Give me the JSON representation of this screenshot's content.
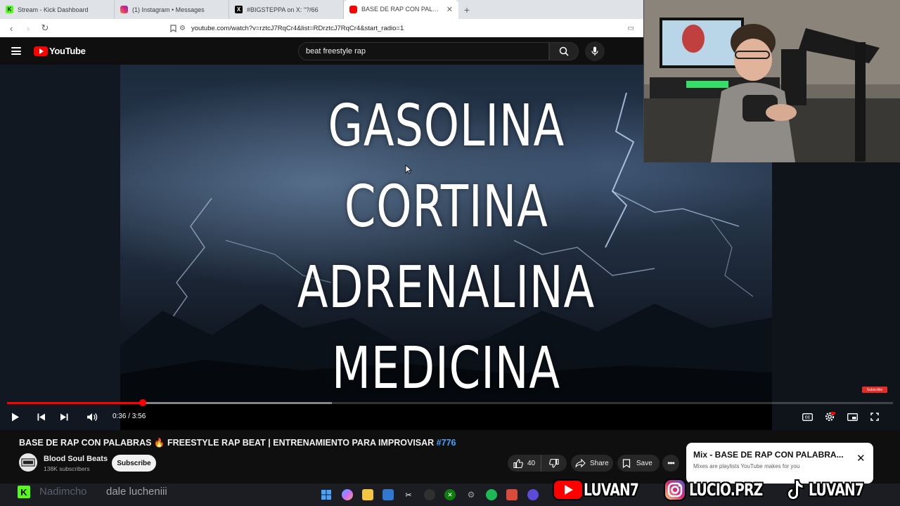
{
  "browser": {
    "tabs": [
      {
        "title": "Stream - Kick Dashboard",
        "icon": "kick-icon",
        "active": false
      },
      {
        "title": "(1) Instagram • Messages",
        "icon": "instagram-icon",
        "active": false
      },
      {
        "title": "#BIGSTEPPA on X: \"?/66",
        "icon": "x-icon",
        "active": false
      },
      {
        "title": "BASE DE RAP CON PALABRAS 🔥",
        "icon": "youtube-icon",
        "active": true
      }
    ],
    "url": "youtube.com/watch?v=rztcJ7RqCr4&list=RDrztcJ7RqCr4&start_radio=1"
  },
  "youtube": {
    "logo_text": "YouTube",
    "search_value": "beat freestyle rap"
  },
  "video": {
    "words": [
      "GASOLINA",
      "CORTINA",
      "ADRENALINA",
      "MEDICINA"
    ],
    "current_time": "0:36",
    "duration": "3:56",
    "time_display": "0:36 / 3:56",
    "played_fraction": 0.153,
    "buffered_fraction": 0.367,
    "subscribe_badge": "Subscribe"
  },
  "details": {
    "title": "BASE DE RAP CON PALABRAS 🔥 FREESTYLE RAP BEAT | ENTRENAMIENTO PARA IMPROVISAR",
    "hashtag": "#776",
    "channel": "Blood Soul Beats",
    "subscribers": "138K subscribers",
    "subscribe_label": "Subscribe",
    "likes": "40",
    "share_label": "Share",
    "save_label": "Save"
  },
  "mix": {
    "title": "Mix - BASE DE RAP CON PALABRA...",
    "subtitle": "Mixes are playlists YouTube makes for you"
  },
  "stream_overlay": {
    "chat_user": "Nadimcho",
    "chat_message": "dale lucheniii",
    "youtube_handle": "LUVAN7",
    "instagram_handle": "LUCIO.PRZ",
    "tiktok_handle": "LUVAN7"
  },
  "colors": {
    "yt_red": "#ff0000",
    "kick_green": "#53fc18",
    "link_blue": "#3ea6ff"
  }
}
